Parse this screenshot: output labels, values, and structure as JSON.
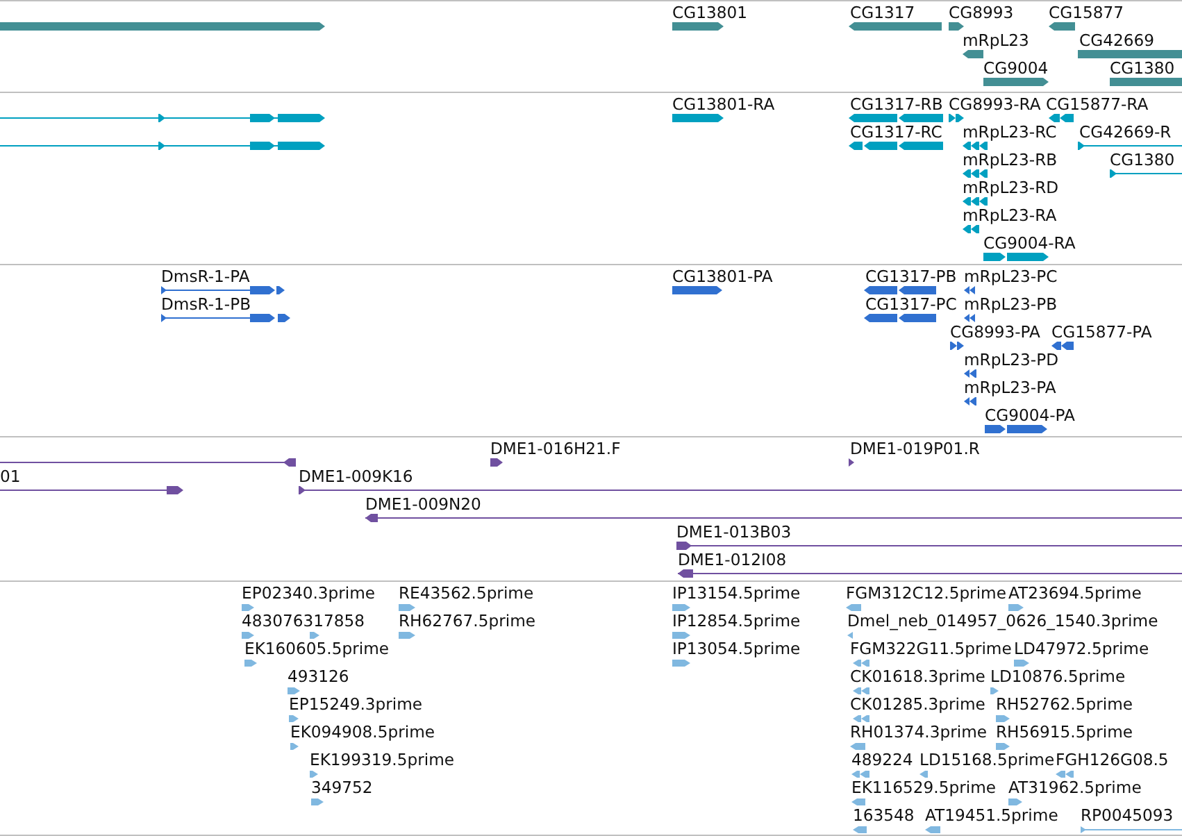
{
  "tracks": [
    {
      "color": "#438f94",
      "features": [
        {
          "reverse": false
        },
        {
          "label": "CG13801",
          "reverse": false
        },
        {
          "label": "CG1317",
          "reverse": true
        },
        {
          "label": "CG8993",
          "reverse": false
        },
        {
          "label": "CG15877",
          "reverse": true
        },
        {
          "label": "mRpL23",
          "reverse": true
        },
        {
          "label": "CG42669",
          "reverse": false
        },
        {
          "label": "CG9004",
          "reverse": false
        },
        {
          "label": "CG1380",
          "reverse": false
        }
      ]
    },
    {
      "color": "#00a0c0",
      "features": [
        {
          "reverse": false
        },
        {
          "label": "CG13801-RA",
          "reverse": false
        },
        {
          "label": "CG1317-RB",
          "reverse": true
        },
        {
          "label": "CG8993-RA",
          "reverse": false
        },
        {
          "label": "CG15877-RA",
          "reverse": true
        },
        {
          "reverse": false
        },
        {
          "label": "CG1317-RC",
          "reverse": true
        },
        {
          "label": "mRpL23-RC",
          "reverse": true
        },
        {
          "label": "CG42669-R",
          "reverse": false
        },
        {
          "label": "mRpL23-RB",
          "reverse": true
        },
        {
          "label": "CG1380",
          "reverse": false
        },
        {
          "label": "mRpL23-RD",
          "reverse": true
        },
        {
          "label": "mRpL23-RA",
          "reverse": true
        },
        {
          "label": "CG9004-RA",
          "reverse": false
        }
      ]
    },
    {
      "color": "#3070d0",
      "features": [
        {
          "label": "DmsR-1-PA",
          "reverse": false
        },
        {
          "label": "CG13801-PA",
          "reverse": false
        },
        {
          "label": "CG1317-PB",
          "reverse": true
        },
        {
          "label": "mRpL23-PC",
          "reverse": true
        },
        {
          "label": "DmsR-1-PB",
          "reverse": false
        },
        {
          "label": "CG1317-PC",
          "reverse": true
        },
        {
          "label": "mRpL23-PB",
          "reverse": true
        },
        {
          "label": "CG8993-PA",
          "reverse": false
        },
        {
          "label": "CG15877-PA",
          "reverse": true
        },
        {
          "label": "mRpL23-PD",
          "reverse": true
        },
        {
          "label": "mRpL23-PA",
          "reverse": true
        },
        {
          "label": "CG9004-PA",
          "reverse": false
        }
      ]
    },
    {
      "color": "#7050a0",
      "features": [
        {
          "reverse": true
        },
        {
          "label": "DME1-016H21.F",
          "reverse": false
        },
        {
          "label": "DME1-019P01.R",
          "reverse": false
        },
        {
          "label": "01",
          "reverse": false
        },
        {
          "label": "DME1-009K16",
          "reverse": false
        },
        {
          "label": "DME1-009N20",
          "reverse": true
        },
        {
          "label": "DME1-013B03",
          "reverse": false
        },
        {
          "label": "DME1-012I08",
          "reverse": true
        }
      ]
    },
    {
      "color": "#80b8e0",
      "features": [
        {
          "label": "EP02340.3prime",
          "reverse": false
        },
        {
          "label": "RE43562.5prime",
          "reverse": false
        },
        {
          "label": "IP13154.5prime",
          "reverse": false
        },
        {
          "label": "FGM312C12.5prime",
          "reverse": true
        },
        {
          "label": "AT23694.5prime",
          "reverse": false
        },
        {
          "label": "483076317858",
          "reverse": false
        },
        {
          "reverse": false
        },
        {
          "label": "RH62767.5prime",
          "reverse": false
        },
        {
          "label": "IP12854.5prime",
          "reverse": false
        },
        {
          "label": "Dmel_neb_014957_0626_1540.3prime",
          "reverse": true
        },
        {
          "label": "EK160605.5prime",
          "reverse": false
        },
        {
          "label": "IP13054.5prime",
          "reverse": false
        },
        {
          "label": "FGM322G11.5prime",
          "reverse": true
        },
        {
          "label": "LD47972.5prime",
          "reverse": false
        },
        {
          "label": "493126",
          "reverse": false
        },
        {
          "label": "CK01618.3prime",
          "reverse": true
        },
        {
          "label": "LD10876.5prime",
          "reverse": false
        },
        {
          "label": "EP15249.3prime",
          "reverse": false
        },
        {
          "label": "CK01285.3prime",
          "reverse": true
        },
        {
          "label": "RH52762.5prime",
          "reverse": false
        },
        {
          "label": "EK094908.5prime",
          "reverse": false
        },
        {
          "label": "RH01374.3prime",
          "reverse": true
        },
        {
          "label": "RH56915.5prime",
          "reverse": false
        },
        {
          "label": "EK199319.5prime",
          "reverse": false
        },
        {
          "label": "489224",
          "reverse": true
        },
        {
          "label": "LD15168.5prime",
          "reverse": true
        },
        {
          "label": "FGH126G08.5",
          "reverse": true
        },
        {
          "label": "349752",
          "reverse": false
        },
        {
          "label": "EK116529.5prime",
          "reverse": true
        },
        {
          "label": "AT31962.5prime",
          "reverse": false
        },
        {
          "label": "163548",
          "reverse": true
        },
        {
          "label": "AT19451.5prime",
          "reverse": true
        },
        {
          "label": "RP0045093",
          "reverse": false
        }
      ]
    }
  ]
}
